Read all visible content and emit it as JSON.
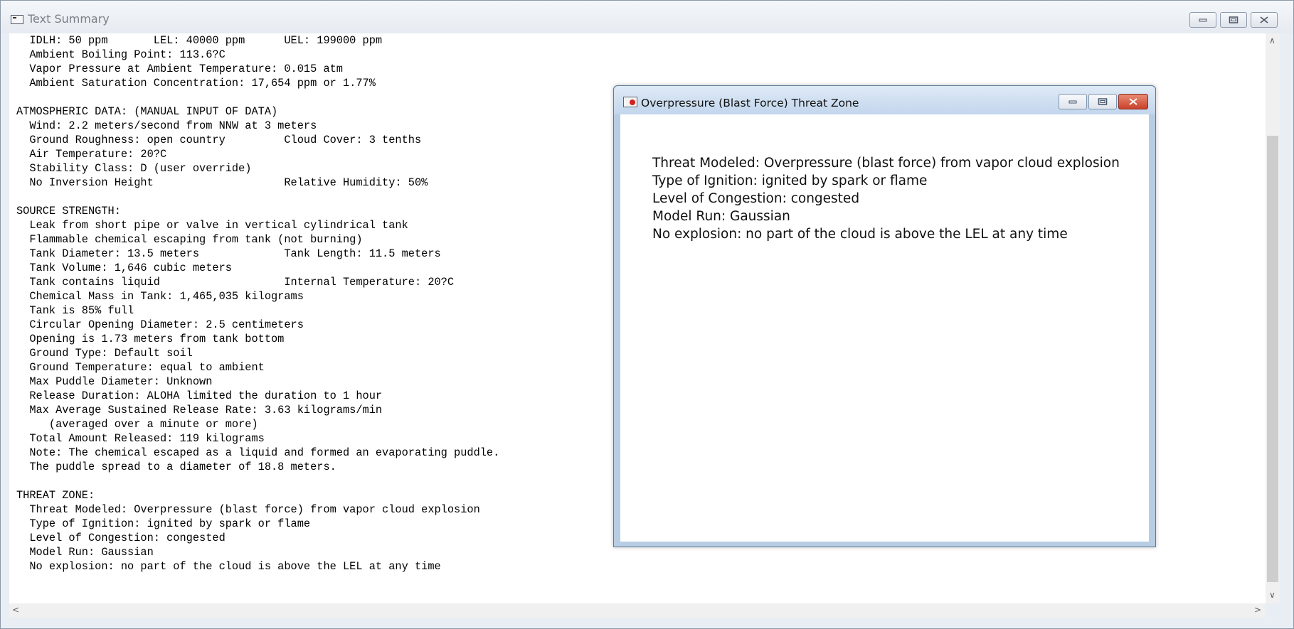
{
  "main_window": {
    "title": "Text Summary",
    "text_lines": [
      "  IDLH: 50 ppm       LEL: 40000 ppm      UEL: 199000 ppm",
      "  Ambient Boiling Point: 113.6?C",
      "  Vapor Pressure at Ambient Temperature: 0.015 atm",
      "  Ambient Saturation Concentration: 17,654 ppm or 1.77%",
      "",
      "ATMOSPHERIC DATA: (MANUAL INPUT OF DATA)",
      "  Wind: 2.2 meters/second from NNW at 3 meters",
      "  Ground Roughness: open country         Cloud Cover: 3 tenths",
      "  Air Temperature: 20?C",
      "  Stability Class: D (user override)",
      "  No Inversion Height                    Relative Humidity: 50%",
      "",
      "SOURCE STRENGTH:",
      "  Leak from short pipe or valve in vertical cylindrical tank",
      "  Flammable chemical escaping from tank (not burning)",
      "  Tank Diameter: 13.5 meters             Tank Length: 11.5 meters",
      "  Tank Volume: 1,646 cubic meters",
      "  Tank contains liquid                   Internal Temperature: 20?C",
      "  Chemical Mass in Tank: 1,465,035 kilograms",
      "  Tank is 85% full",
      "  Circular Opening Diameter: 2.5 centimeters",
      "  Opening is 1.73 meters from tank bottom",
      "  Ground Type: Default soil",
      "  Ground Temperature: equal to ambient",
      "  Max Puddle Diameter: Unknown",
      "  Release Duration: ALOHA limited the duration to 1 hour",
      "  Max Average Sustained Release Rate: 3.63 kilograms/min",
      "     (averaged over a minute or more)",
      "  Total Amount Released: 119 kilograms",
      "  Note: The chemical escaped as a liquid and formed an evaporating puddle.",
      "  The puddle spread to a diameter of 18.8 meters.",
      "",
      "THREAT ZONE:",
      "  Threat Modeled: Overpressure (blast force) from vapor cloud explosion",
      "  Type of Ignition: ignited by spark or flame",
      "  Level of Congestion: congested",
      "  Model Run: Gaussian",
      "  No explosion: no part of the cloud is above the LEL at any time"
    ]
  },
  "child_window": {
    "title": "Overpressure (Blast Force) Threat Zone",
    "lines": [
      "Threat Modeled: Overpressure (blast force) from vapor cloud explosion",
      "Type of Ignition: ignited by spark or flame",
      "Level of Congestion: congested",
      "Model Run: Gaussian",
      "No explosion: no part of the cloud is above the LEL at any time"
    ]
  }
}
